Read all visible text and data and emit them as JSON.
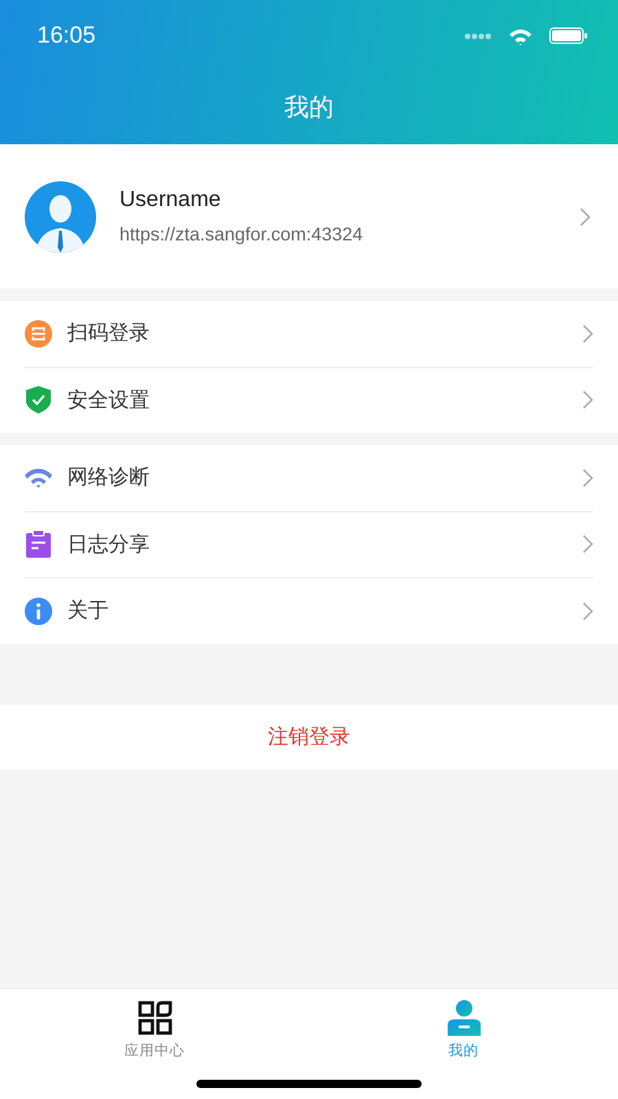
{
  "status_bar": {
    "time": "16:05"
  },
  "header": {
    "title": "我的"
  },
  "profile": {
    "username": "Username",
    "server": "https://zta.sangfor.com:43324"
  },
  "menu_groups": [
    {
      "items": [
        {
          "kind": "scan",
          "label": "扫码登录"
        },
        {
          "kind": "shield",
          "label": "安全设置"
        }
      ]
    },
    {
      "items": [
        {
          "kind": "wifi",
          "label": "网络诊断"
        },
        {
          "kind": "clipboard",
          "label": "日志分享"
        },
        {
          "kind": "info",
          "label": "关于"
        }
      ]
    }
  ],
  "logout": {
    "label": "注销登录"
  },
  "tabs": [
    {
      "kind": "apps",
      "label": "应用中心",
      "selected": false
    },
    {
      "kind": "me",
      "label": "我的",
      "selected": true
    }
  ]
}
